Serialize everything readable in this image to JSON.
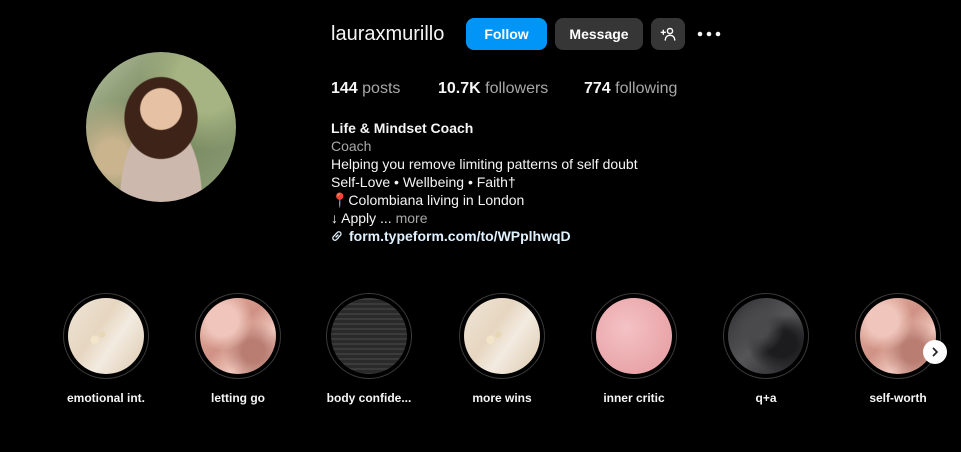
{
  "profile": {
    "username": "lauraxmurillo",
    "actions": {
      "follow_label": "Follow",
      "message_label": "Message",
      "suggest_icon": "add-person-icon",
      "more_icon": "more-horizontal-icon"
    },
    "stats": {
      "posts_count": "144",
      "posts_label": "posts",
      "followers_count": "10.7K",
      "followers_label": "followers",
      "following_count": "774",
      "following_label": "following"
    },
    "bio": {
      "name": "Life & Mindset Coach",
      "category": "Coach",
      "line1": "Helping you remove limiting patterns of self doubt",
      "line2": "Self-Love • Wellbeing • Faith†",
      "line3": "📍Colombiana living in London",
      "line4": "↓ Apply ...",
      "more_label": "more",
      "link_text": "form.typeform.com/to/WPplhwqD",
      "link_icon": "link-icon"
    }
  },
  "highlights": [
    {
      "label": "emotional int.",
      "cover": "beige"
    },
    {
      "label": "letting go",
      "cover": "silk"
    },
    {
      "label": "body confide...",
      "cover": "text"
    },
    {
      "label": "more wins",
      "cover": "beige"
    },
    {
      "label": "inner critic",
      "cover": "pink"
    },
    {
      "label": "q+a",
      "cover": "dark"
    },
    {
      "label": "self-worth",
      "cover": "silk"
    }
  ],
  "navigation": {
    "next_icon": "chevron-right-icon"
  },
  "colors": {
    "follow_button": "#0095f6",
    "secondary_button": "#363636",
    "background": "#000000"
  }
}
